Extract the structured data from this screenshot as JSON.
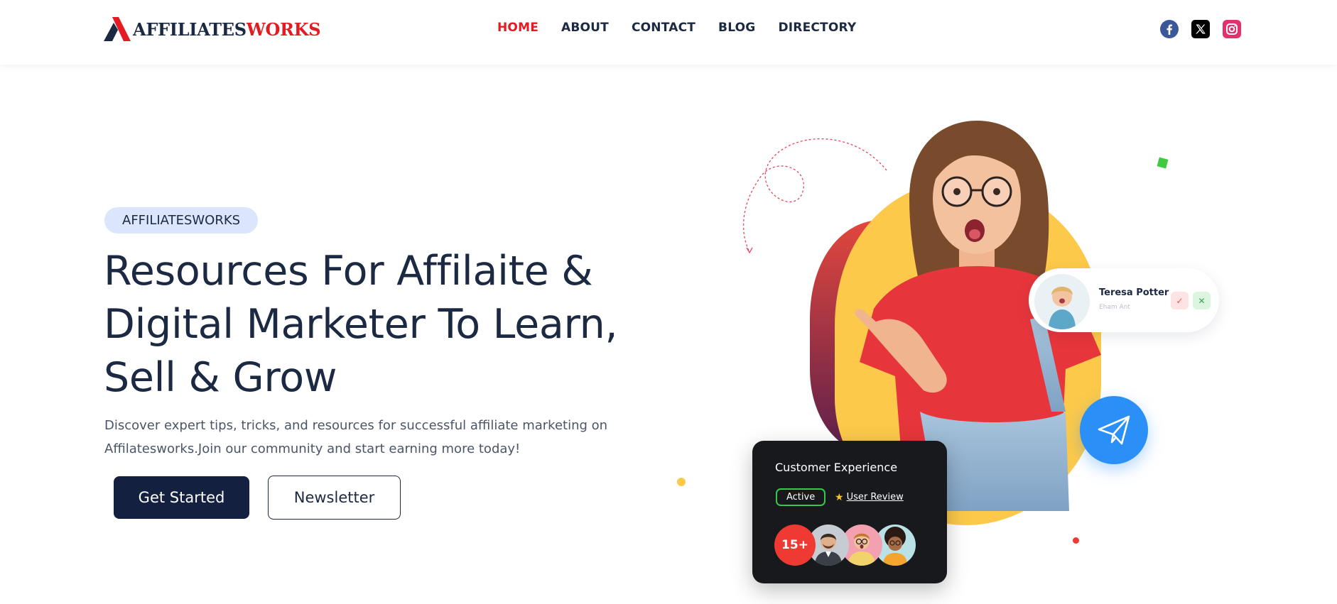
{
  "header": {
    "logo": {
      "part1": "AFFILIATES",
      "part2": "WORKS"
    },
    "nav": [
      {
        "label": "HOME",
        "active": true
      },
      {
        "label": "ABOUT",
        "active": false
      },
      {
        "label": "CONTACT",
        "active": false
      },
      {
        "label": "BLOG",
        "active": false
      },
      {
        "label": "DIRECTORY",
        "active": false
      }
    ],
    "socials": [
      {
        "icon": "facebook-icon",
        "color": "#3b5998"
      },
      {
        "icon": "x-icon",
        "color": "#000000"
      },
      {
        "icon": "instagram-icon",
        "color": "#e1306c"
      }
    ]
  },
  "hero": {
    "badge": "AFFILIATESWORKS",
    "title_lines": [
      "Resources For Affilaite &",
      "Digital Marketer To Learn,",
      "Sell & Grow"
    ],
    "description_lines": [
      "Discover expert tips, tricks, and resources for successful affiliate marketing on",
      "Affilatesworks.Join our community and start earning more today!"
    ],
    "primary_button": "Get Started",
    "secondary_button": "Newsletter"
  },
  "profile_card": {
    "name": "Teresa Potter",
    "role": "Eham Ant"
  },
  "experience_card": {
    "title": "Customer Experience",
    "status": "Active",
    "review_label": "User Review",
    "count": "15+"
  },
  "colors": {
    "brand_dark": "#1c2942",
    "brand_red": "#e41b23",
    "accent_blue": "#2a8ff7",
    "accent_yellow": "#fcc94a",
    "badge_bg": "#dbe5fb"
  }
}
